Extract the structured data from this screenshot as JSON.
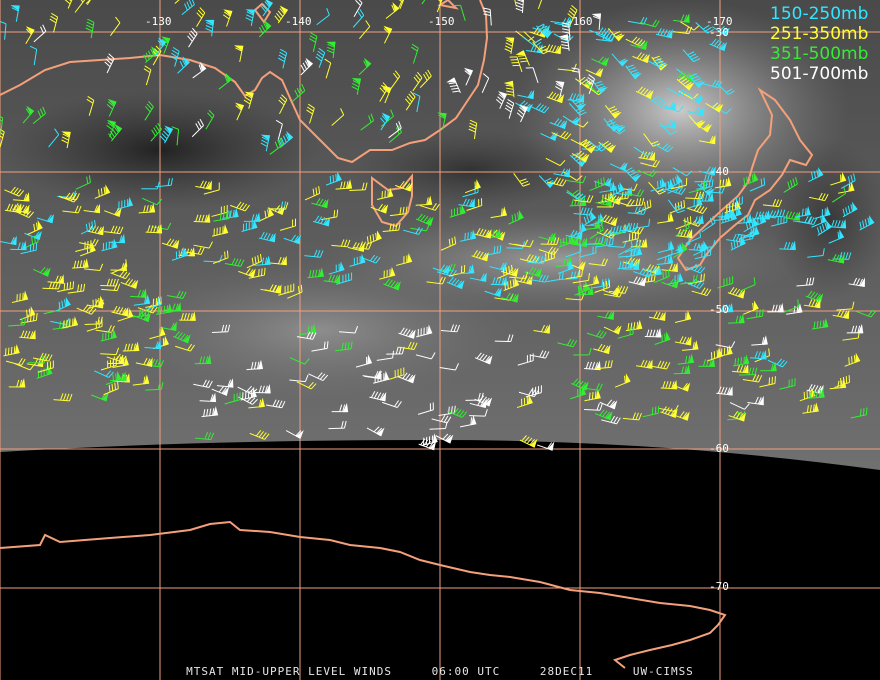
{
  "map": {
    "longitude_labels": [
      "-130",
      "-140",
      "-150",
      "-160",
      "-170"
    ],
    "latitude_labels": [
      "-30",
      "-40",
      "-50",
      "-60",
      "-70"
    ]
  },
  "legend": [
    {
      "label": "150-250mb",
      "color": "#33e6ff"
    },
    {
      "label": "251-350mb",
      "color": "#ffff33"
    },
    {
      "label": "351-500mb",
      "color": "#33ee33"
    },
    {
      "label": "501-700mb",
      "color": "#ffffff"
    }
  ],
  "colors": {
    "graticule": "#f0a080",
    "coastline": "#f4a07a",
    "space": "#000000"
  },
  "footer": {
    "product": "MTSAT MID-UPPER LEVEL WINDS",
    "time": "06:00 UTC",
    "date": "28DEC11",
    "source": "UW-CIMSS"
  }
}
